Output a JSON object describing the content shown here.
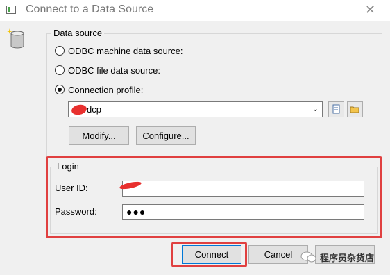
{
  "window": {
    "title": "Connect to a Data Source",
    "close": "✕"
  },
  "datasource": {
    "legend": "Data source",
    "options": [
      {
        "label": "ODBC machine data source:",
        "checked": false
      },
      {
        "label": "ODBC file data source:",
        "checked": false
      },
      {
        "label": "Connection profile:",
        "checked": true
      }
    ],
    "profile_value": "dcp",
    "modify_label": "Modify...",
    "configure_label": "Configure..."
  },
  "login": {
    "legend": "Login",
    "user_label": "User ID:",
    "user_value": "",
    "password_label": "Password:",
    "password_value": "●●●"
  },
  "actions": {
    "connect_label": "Connect",
    "cancel_label": "Cancel"
  },
  "watermark": {
    "text": "程序员杂货店"
  },
  "colors": {
    "highlight": "#e04040",
    "redaction": "#e8302e"
  }
}
